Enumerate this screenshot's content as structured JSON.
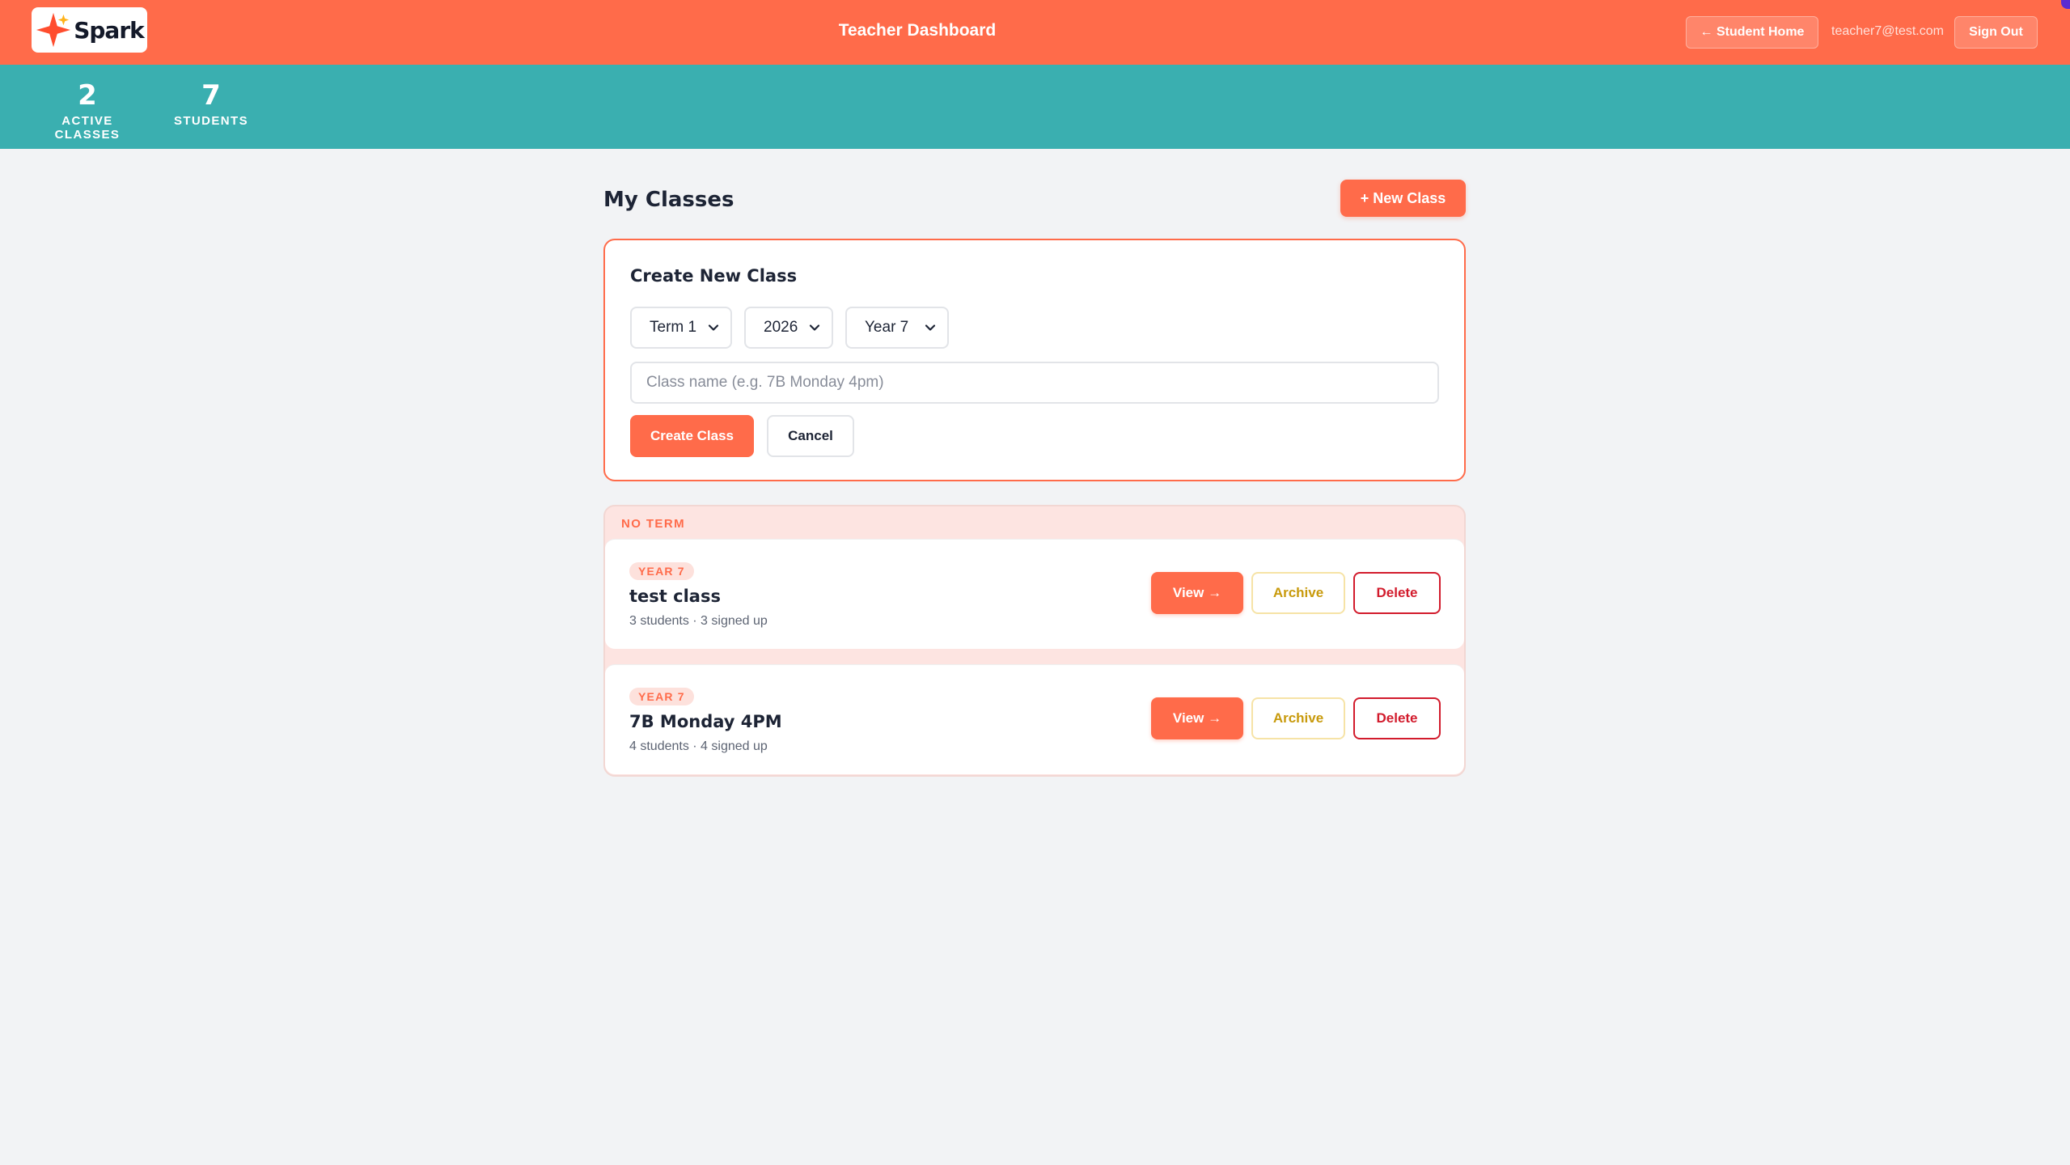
{
  "header": {
    "logo_text": "Spark",
    "title": "Teacher Dashboard",
    "student_home_label": "← Student Home",
    "user_email": "teacher7@test.com",
    "sign_out_label": "Sign Out"
  },
  "stats": [
    {
      "value": "2",
      "label": "ACTIVE CLASSES"
    },
    {
      "value": "7",
      "label": "STUDENTS"
    }
  ],
  "main": {
    "title": "My Classes",
    "new_class_label": "+ New Class"
  },
  "create_form": {
    "title": "Create New Class",
    "term_selected": "Term 1",
    "year_selected": "2026",
    "year_level_selected": "Year 7",
    "class_name_placeholder": "Class name (e.g. 7B Monday 4pm)",
    "class_name_value": "",
    "create_label": "Create Class",
    "cancel_label": "Cancel"
  },
  "groups": [
    {
      "label": "NO TERM",
      "classes": [
        {
          "badge": "YEAR 7",
          "name": "test class",
          "meta": "3 students · 3 signed up",
          "view_label": "View →",
          "archive_label": "Archive",
          "delete_label": "Delete"
        },
        {
          "badge": "YEAR 7",
          "name": "7B Monday 4PM",
          "meta": "4 students · 4 signed up",
          "view_label": "View →",
          "archive_label": "Archive",
          "delete_label": "Delete"
        }
      ]
    }
  ],
  "colors": {
    "brand": "#ff6b4a",
    "teal": "#3aafb0",
    "archive": "#c89a0c",
    "delete": "#d21b2c"
  },
  "icons": [
    "spark-logo-icon",
    "chevron-down-icon"
  ]
}
